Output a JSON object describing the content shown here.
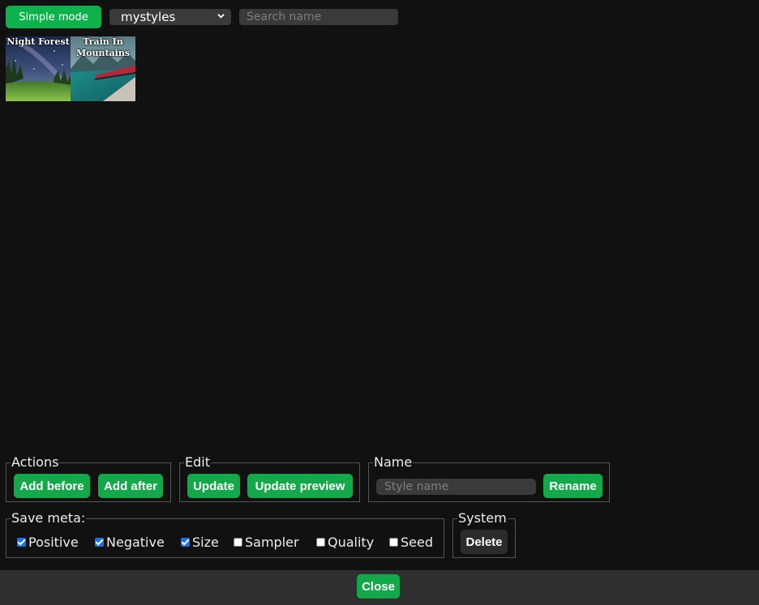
{
  "toolbar": {
    "simple_mode_label": "Simple mode",
    "style_select_value": "mystyles",
    "search_placeholder": "Search name"
  },
  "gallery": [
    {
      "caption": "Night Forest"
    },
    {
      "caption": "Train In Mountains"
    }
  ],
  "actions": {
    "legend": "Actions",
    "add_before": "Add before",
    "add_after": "Add after"
  },
  "edit": {
    "legend": "Edit",
    "update": "Update",
    "update_preview": "Update preview"
  },
  "name": {
    "legend": "Name",
    "placeholder": "Style name",
    "rename": "Rename"
  },
  "save_meta": {
    "legend": "Save meta:",
    "options": [
      {
        "label": "Positive",
        "checked": true
      },
      {
        "label": "Negative",
        "checked": true
      },
      {
        "label": "Size",
        "checked": true
      },
      {
        "label": "Sampler",
        "checked": false
      },
      {
        "label": "Quality",
        "checked": false
      },
      {
        "label": "Seed",
        "checked": false
      }
    ]
  },
  "system": {
    "legend": "System",
    "delete": "Delete"
  },
  "footer": {
    "close": "Close"
  },
  "colors": {
    "background": "#111111",
    "accent_green": "#13a94a",
    "checkbox_blue": "#1a73e8",
    "footer_bar": "#2f2f2f"
  }
}
